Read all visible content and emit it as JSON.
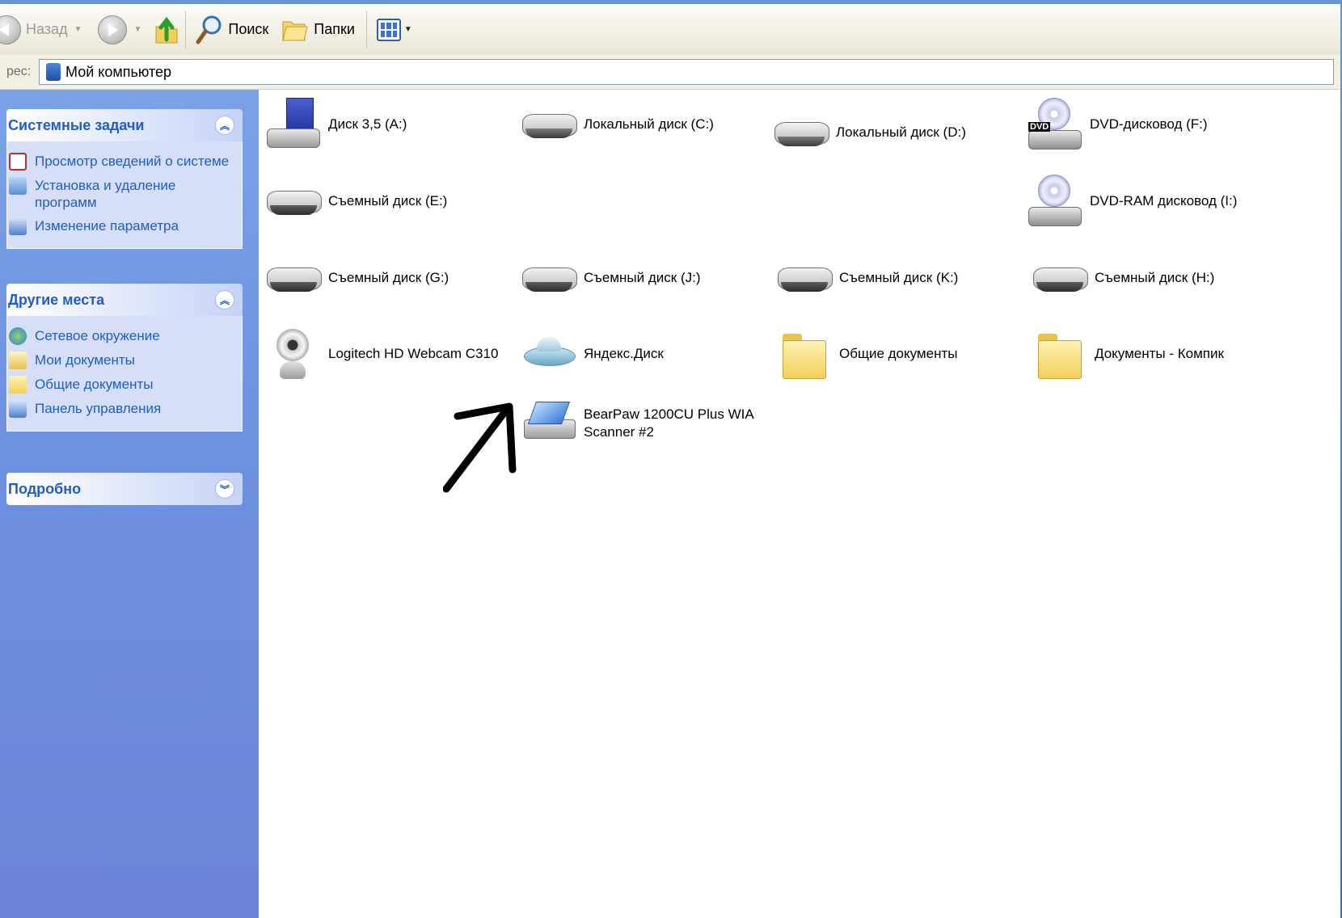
{
  "toolbar": {
    "back_label": "Назад",
    "search_label": "Поиск",
    "folders_label": "Папки"
  },
  "address": {
    "label": "рес:",
    "value": "Мой компьютер"
  },
  "panels": [
    {
      "title": "Системные задачи",
      "items": [
        "Просмотр сведений о системе",
        "Установка и удаление программ",
        "Изменение параметра"
      ]
    },
    {
      "title": "Другие места",
      "items": [
        "Сетевое окружение",
        "Мои документы",
        "Общие документы",
        "Панель управления"
      ]
    },
    {
      "title": "Подробно",
      "items": []
    }
  ],
  "items": {
    "floppy_a": "Диск 3,5 (A:)",
    "disk_c": "Локальный диск (C:)",
    "disk_d": "Локальный диск (D:)",
    "dvd_f": "DVD-дисковод (F:)",
    "removable_e": "Съемный диск (E:)",
    "dvdram_i": "DVD-RAM дисковод (I:)",
    "removable_g": "Съемный диск (G:)",
    "removable_j": "Съемный диск (J:)",
    "removable_k": "Съемный диск (K:)",
    "removable_h": "Съемный диск (H:)",
    "webcam": "Logitech HD Webcam C310",
    "yandex": "Яндекс.Диск",
    "shared_docs": "Общие документы",
    "komp_docs": "Документы - Компик",
    "scanner_line1": "BearPaw 1200CU Plus WIA",
    "scanner_line2": "Scanner #2"
  },
  "icons": {
    "dvd_tag": "DVD"
  }
}
